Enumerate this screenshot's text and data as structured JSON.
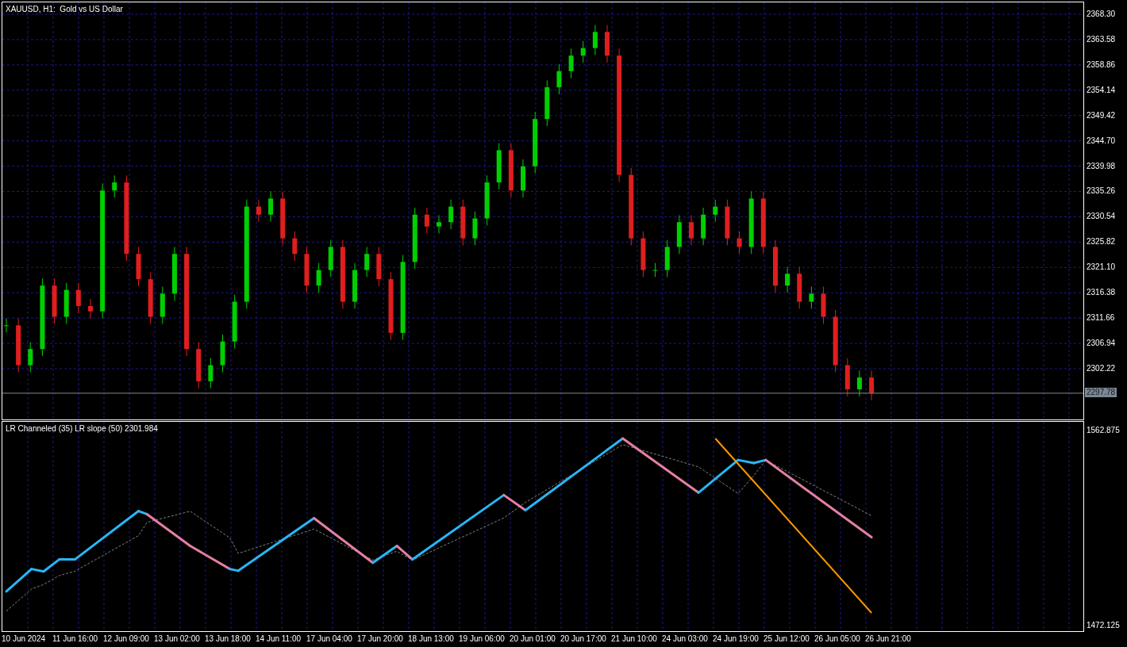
{
  "price_chart": {
    "title": "XAUUSD, H1:  Gold vs US Dollar",
    "axis_labels": [
      "2368.30",
      "2363.58",
      "2358.86",
      "2354.14",
      "2349.42",
      "2344.70",
      "2339.98",
      "2335.26",
      "2330.54",
      "2325.82",
      "2321.10",
      "2316.38",
      "2311.66",
      "2306.94",
      "2302.22"
    ],
    "price_tag": "2297.78"
  },
  "indicator": {
    "title": "LR Channeled (35) LR slope (50) 2301.984",
    "axis_labels": [
      "1562.875",
      "1472.125"
    ]
  },
  "time_axis": {
    "labels": [
      "10 Jun 2024",
      "11 Jun 16:00",
      "12 Jun 09:00",
      "13 Jun 02:00",
      "13 Jun 18:00",
      "14 Jun 11:00",
      "17 Jun 04:00",
      "17 Jun 20:00",
      "18 Jun 13:00",
      "19 Jun 06:00",
      "20 Jun 01:00",
      "20 Jun 17:00",
      "21 Jun 10:00",
      "24 Jun 03:00",
      "24 Jun 19:00",
      "25 Jun 12:00",
      "26 Jun 05:00",
      "26 Jun 21:00"
    ]
  }
}
